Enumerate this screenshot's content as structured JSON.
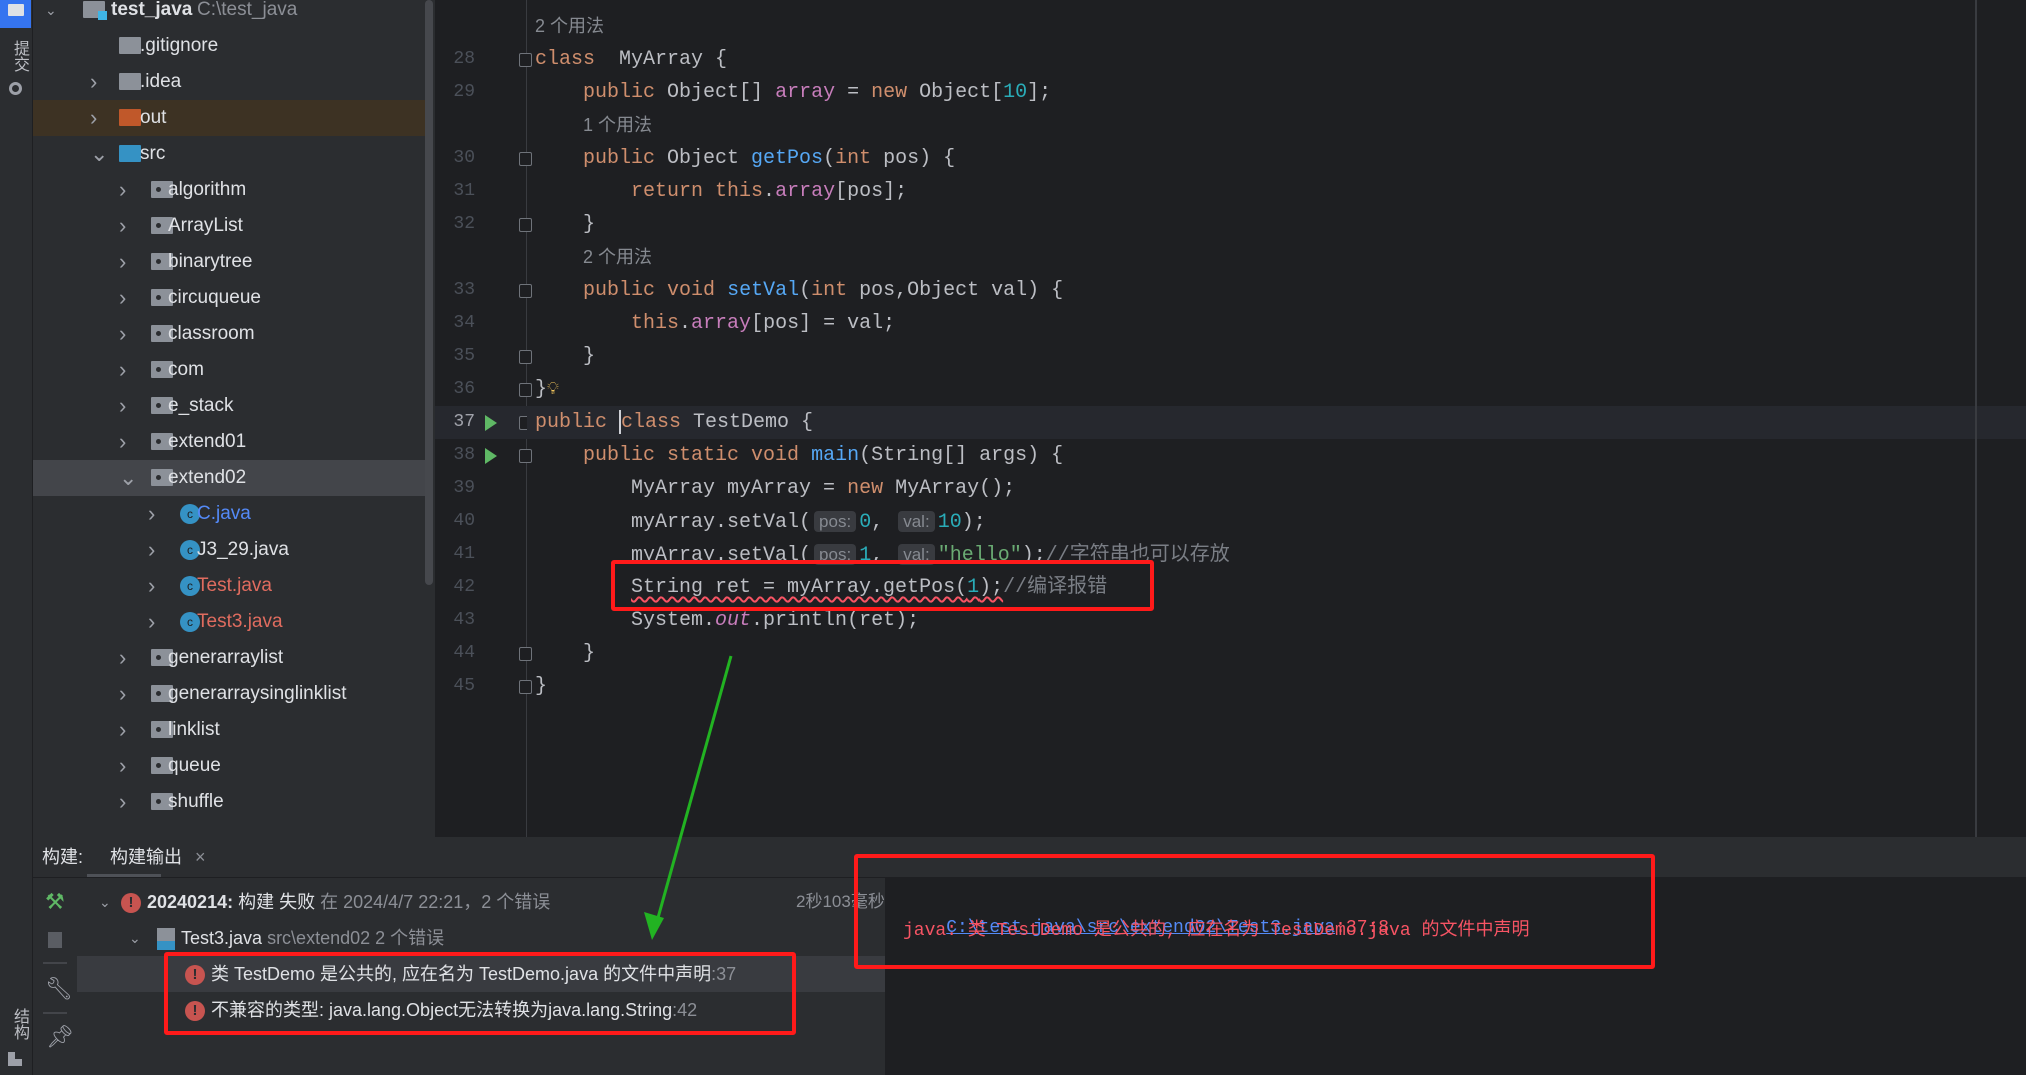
{
  "colors": {
    "accent": "#3574f0",
    "error": "#f75464",
    "annotation_box": "#ff1a1a",
    "arrow": "#22b322"
  },
  "left_stripe": {
    "commit_label": "提交",
    "structure_label": "结构"
  },
  "project_tree": {
    "root": {
      "name": "test_java",
      "path": "C:\\test_java"
    },
    "items": [
      {
        "label": ".gitignore",
        "depth": 1,
        "icon": "ignore-file-icon",
        "expand": "none"
      },
      {
        "label": ".idea",
        "depth": 1,
        "icon": "folder-icon",
        "expand": "collapsed"
      },
      {
        "label": "out",
        "depth": 1,
        "icon": "excluded-folder-icon",
        "expand": "collapsed",
        "state": "out"
      },
      {
        "label": "src",
        "depth": 1,
        "icon": "source-folder-icon",
        "expand": "expanded"
      },
      {
        "label": "algorithm",
        "depth": 2,
        "icon": "package-icon",
        "expand": "collapsed"
      },
      {
        "label": "ArrayList",
        "depth": 2,
        "icon": "package-icon",
        "expand": "collapsed"
      },
      {
        "label": "binarytree",
        "depth": 2,
        "icon": "package-icon",
        "expand": "collapsed"
      },
      {
        "label": "circuqueue",
        "depth": 2,
        "icon": "package-icon",
        "expand": "collapsed"
      },
      {
        "label": "classroom",
        "depth": 2,
        "icon": "package-icon",
        "expand": "collapsed"
      },
      {
        "label": "com",
        "depth": 2,
        "icon": "package-icon",
        "expand": "collapsed"
      },
      {
        "label": "e_stack",
        "depth": 2,
        "icon": "package-icon",
        "expand": "collapsed"
      },
      {
        "label": "extend01",
        "depth": 2,
        "icon": "package-icon",
        "expand": "collapsed"
      },
      {
        "label": "extend02",
        "depth": 2,
        "icon": "package-icon",
        "expand": "expanded",
        "state": "selected"
      },
      {
        "label": "C.java",
        "depth": 3,
        "icon": "java-class-icon",
        "expand": "collapsed",
        "color": "#548af7"
      },
      {
        "label": "J3_29.java",
        "depth": 3,
        "icon": "java-class-icon",
        "expand": "collapsed"
      },
      {
        "label": "Test.java",
        "depth": 3,
        "icon": "java-class-icon",
        "expand": "collapsed",
        "color": "#e06c5f"
      },
      {
        "label": "Test3.java",
        "depth": 3,
        "icon": "java-runnable-class-icon",
        "expand": "collapsed",
        "color": "#e06c5f"
      },
      {
        "label": "generarraylist",
        "depth": 2,
        "icon": "package-icon",
        "expand": "collapsed"
      },
      {
        "label": "generarraysinglinklist",
        "depth": 2,
        "icon": "package-icon",
        "expand": "collapsed"
      },
      {
        "label": "linklist",
        "depth": 2,
        "icon": "package-icon",
        "expand": "collapsed"
      },
      {
        "label": "queue",
        "depth": 2,
        "icon": "package-icon",
        "expand": "collapsed"
      },
      {
        "label": "shuffle",
        "depth": 2,
        "icon": "package-icon",
        "expand": "collapsed"
      }
    ]
  },
  "editor": {
    "current_line": 37,
    "rows": [
      {
        "hint": "2 个用法",
        "indent": 0
      },
      {
        "line": 28,
        "fold": "start",
        "tokens": [
          [
            "kw",
            "class"
          ],
          [
            "",
            "  MyArray {"
          ]
        ]
      },
      {
        "line": 29,
        "tokens": [
          [
            "",
            "    "
          ],
          [
            "kw",
            "public"
          ],
          [
            "",
            " Object[] "
          ],
          [
            "fd",
            "array"
          ],
          [
            "",
            " = "
          ],
          [
            "kw",
            "new"
          ],
          [
            "",
            " Object["
          ],
          [
            "nm",
            "10"
          ],
          [
            "",
            "];"
          ]
        ]
      },
      {
        "hint": "1 个用法",
        "indent": 4
      },
      {
        "line": 30,
        "fold": "start",
        "tokens": [
          [
            "",
            "    "
          ],
          [
            "kw",
            "public"
          ],
          [
            "",
            " Object "
          ],
          [
            "fn",
            "getPos"
          ],
          [
            "",
            "("
          ],
          [
            "kw",
            "int"
          ],
          [
            "",
            " pos) {"
          ]
        ]
      },
      {
        "line": 31,
        "tokens": [
          [
            "",
            "        "
          ],
          [
            "kw",
            "return this"
          ],
          [
            "",
            "."
          ],
          [
            "fd",
            "array"
          ],
          [
            "",
            "[pos];"
          ]
        ]
      },
      {
        "line": 32,
        "fold": "end",
        "tokens": [
          [
            "",
            "    }"
          ]
        ]
      },
      {
        "hint": "2 个用法",
        "indent": 4
      },
      {
        "line": 33,
        "fold": "start",
        "tokens": [
          [
            "",
            "    "
          ],
          [
            "kw",
            "public void"
          ],
          [
            "",
            " "
          ],
          [
            "fn",
            "setVal"
          ],
          [
            "",
            "("
          ],
          [
            "kw",
            "int"
          ],
          [
            "",
            " pos,Object val) {"
          ]
        ]
      },
      {
        "line": 34,
        "tokens": [
          [
            "",
            "        "
          ],
          [
            "kw",
            "this"
          ],
          [
            "",
            "."
          ],
          [
            "fd",
            "array"
          ],
          [
            "",
            "[pos] = val;"
          ]
        ]
      },
      {
        "line": 35,
        "fold": "end",
        "tokens": [
          [
            "",
            "    }"
          ]
        ]
      },
      {
        "line": 36,
        "fold": "end",
        "bulb": true,
        "tokens": [
          [
            "",
            "}"
          ]
        ]
      },
      {
        "line": 37,
        "fold": "start",
        "run": true,
        "tokens": [
          [
            "kw",
            "public "
          ],
          [
            "caret",
            ""
          ],
          [
            "kw",
            "class"
          ],
          [
            "",
            " TestDemo {"
          ]
        ]
      },
      {
        "line": 38,
        "fold": "start",
        "run": true,
        "tokens": [
          [
            "",
            "    "
          ],
          [
            "kw",
            "public static void"
          ],
          [
            "",
            " "
          ],
          [
            "fn",
            "main"
          ],
          [
            "",
            "(String[] args) {"
          ]
        ]
      },
      {
        "line": 39,
        "tokens": [
          [
            "",
            "        MyArray myArray = "
          ],
          [
            "kw",
            "new"
          ],
          [
            "",
            " MyArray();"
          ]
        ]
      },
      {
        "line": 40,
        "tokens": [
          [
            "",
            "        myArray.setVal("
          ],
          [
            "ih",
            "pos:"
          ],
          [
            "nm",
            "0"
          ],
          [
            "",
            ", "
          ],
          [
            "ih",
            "val:"
          ],
          [
            "nm",
            "10"
          ],
          [
            "",
            ");"
          ]
        ]
      },
      {
        "line": 41,
        "tokens": [
          [
            "",
            "        myArray.setVal("
          ],
          [
            "ih",
            "pos:"
          ],
          [
            "nm",
            "1"
          ],
          [
            "",
            ", "
          ],
          [
            "ih",
            "val:"
          ],
          [
            "st",
            "\"hello\""
          ],
          [
            "",
            ");"
          ],
          [
            "cm",
            "//字符串也可以存放"
          ]
        ]
      },
      {
        "line": 42,
        "tokens": [
          [
            "",
            "        "
          ],
          [
            "err",
            "String ret = myArray.getPos("
          ],
          [
            "errnm",
            "1"
          ],
          [
            "err",
            ");"
          ],
          [
            "cm",
            "//编译报错"
          ]
        ]
      },
      {
        "line": 43,
        "tokens": [
          [
            "",
            "        System."
          ],
          [
            "sf",
            "out"
          ],
          [
            "",
            ".println(ret);"
          ]
        ]
      },
      {
        "line": 44,
        "fold": "end",
        "tokens": [
          [
            "",
            "    }"
          ]
        ]
      },
      {
        "line": 45,
        "fold": "end",
        "tokens": [
          [
            "",
            "}"
          ]
        ]
      }
    ]
  },
  "build": {
    "header": "构建:",
    "tab_label": "构建输出",
    "tab_close": "×",
    "summary": {
      "name": "20240214:",
      "status": "构建 失败",
      "detail": "在 2024/4/7 22:21，2 个错误",
      "duration": "2秒103毫秒"
    },
    "file": {
      "name": "Test3.java",
      "path": "src\\extend02",
      "count": "2 个错误"
    },
    "errors": [
      {
        "message": "类 TestDemo 是公共的, 应在名为 TestDemo.java 的文件中声明",
        "line": ":37"
      },
      {
        "message": "不兼容的类型: java.lang.Object无法转换为java.lang.String",
        "line": ":42"
      }
    ]
  },
  "console": {
    "link": "C:\\test_java\\src\\extend02\\Test3.java",
    "position": ":37:8",
    "message": "java: 类 TestDemo 是公共的, 应在名为 TestDemo.java 的文件中声明"
  }
}
